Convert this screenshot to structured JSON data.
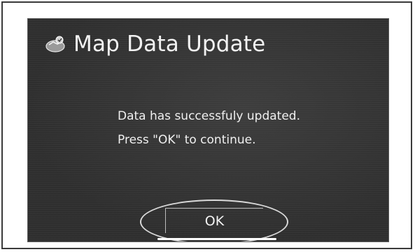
{
  "dialog": {
    "title": "Map Data Update",
    "icon": "map-update-icon",
    "message_line1": "Data has successfuly updated.",
    "message_line2": "Press \"OK\" to continue.",
    "ok_label": "OK"
  },
  "colors": {
    "screen_background": "#2e2e2e",
    "text": "#f0f0f0",
    "frame_border": "#3a3a3a"
  }
}
